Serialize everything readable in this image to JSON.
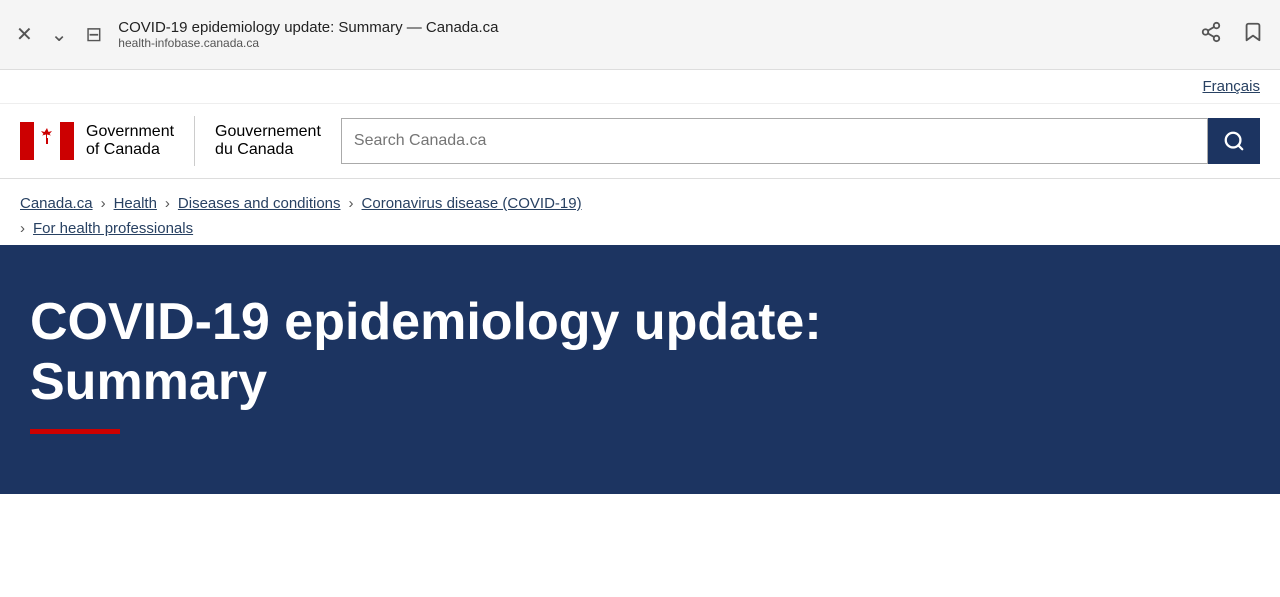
{
  "browser": {
    "close_label": "✕",
    "chevron_label": "⌄",
    "filter_label": "⊟",
    "title": "COVID-19 epidemiology update: Summary — Canada.ca",
    "url": "health-infobase.canada.ca",
    "share_label": "⎋",
    "bookmark_label": "☐"
  },
  "header": {
    "francais_label": "Français"
  },
  "gov": {
    "name_en_line1": "Government",
    "name_en_line2": "of Canada",
    "name_fr_line1": "Gouvernement",
    "name_fr_line2": "du Canada",
    "search_placeholder": "Search Canada.ca",
    "search_button_label": "🔍"
  },
  "breadcrumb": {
    "canada_ca": "Canada.ca",
    "health": "Health",
    "diseases": "Diseases and conditions",
    "coronavirus": "Coronavirus disease (COVID-19)",
    "for_health_professionals": "For health professionals"
  },
  "hero": {
    "title": "COVID-19 epidemiology update: Summary"
  }
}
